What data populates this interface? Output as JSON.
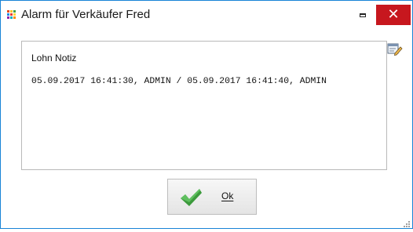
{
  "window": {
    "title": "Alarm für Verkäufer Fred",
    "close_glyph": "✕",
    "icons": {
      "app": "colored-grid-icon",
      "minimize": "minimize-icon",
      "close": "close-icon",
      "edit": "edit-note-icon",
      "ok": "checkmark-icon",
      "resize": "resize-grip-icon"
    },
    "colors": {
      "border": "#1883d7",
      "close_bg": "#c7171e",
      "check_green": "#3c9a3c"
    }
  },
  "note": {
    "label": "Lohn Notiz",
    "text": "05.09.2017 16:41:30, ADMIN / 05.09.2017 16:41:40, ADMIN"
  },
  "buttons": {
    "ok_label": "Ok"
  }
}
